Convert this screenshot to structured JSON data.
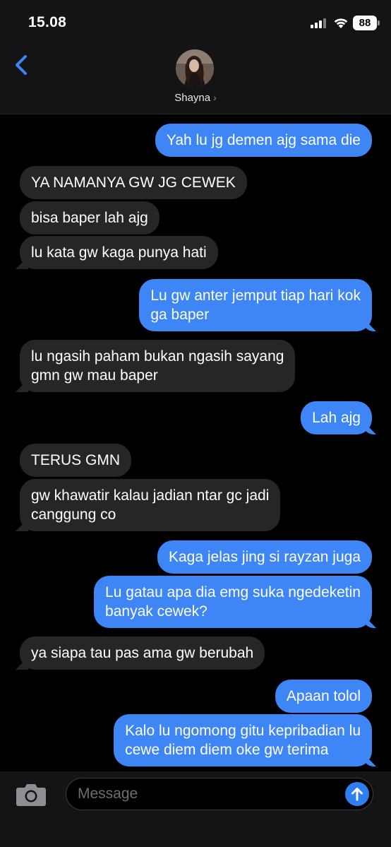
{
  "status_bar": {
    "time": "15.08",
    "battery": "88"
  },
  "header": {
    "contact_name": "Shayna",
    "contact_chevron": "›"
  },
  "messages": [
    {
      "side": "out",
      "text": "Yah lu jg demen ajg sama die"
    },
    {
      "side": "in",
      "text": "YA NAMANYA GW JG CEWEK"
    },
    {
      "side": "in",
      "text": "bisa baper lah ajg"
    },
    {
      "side": "in",
      "text": "lu kata gw kaga punya hati"
    },
    {
      "side": "out",
      "lines": [
        "Lu gw anter jemput tiap hari kok",
        "ga baper"
      ]
    },
    {
      "side": "in",
      "lines": [
        "lu ngasih paham bukan ngasih sayang",
        "gmn gw mau baper"
      ]
    },
    {
      "side": "out",
      "text": "Lah ajg"
    },
    {
      "side": "in",
      "text": "TERUS GMN"
    },
    {
      "side": "in",
      "lines": [
        "gw khawatir kalau jadian ntar gc jadi",
        "canggung co"
      ]
    },
    {
      "side": "out",
      "text": "Kaga jelas jing si rayzan juga"
    },
    {
      "side": "out",
      "lines": [
        "Lu gatau apa dia emg suka ngedeketin",
        "banyak cewek?"
      ]
    },
    {
      "side": "in",
      "text": "ya siapa tau pas ama gw berubah"
    },
    {
      "side": "out",
      "text": "Apaan tolol"
    },
    {
      "side": "out",
      "lines": [
        "Kalo lu ngomong gitu kepribadian lu",
        "cewe diem diem oke gw terima"
      ]
    }
  ],
  "composer": {
    "placeholder": "Message"
  },
  "colors": {
    "outgoing_bubble": "#3e85f5",
    "incoming_bubble": "#262628",
    "accent": "#2f7ff2"
  },
  "icons": {
    "back": "chevron-left-icon",
    "camera": "camera-icon",
    "send": "arrow-up-icon",
    "wifi": "wifi-icon",
    "signal": "cellular-signal-icon",
    "battery": "battery-icon"
  }
}
